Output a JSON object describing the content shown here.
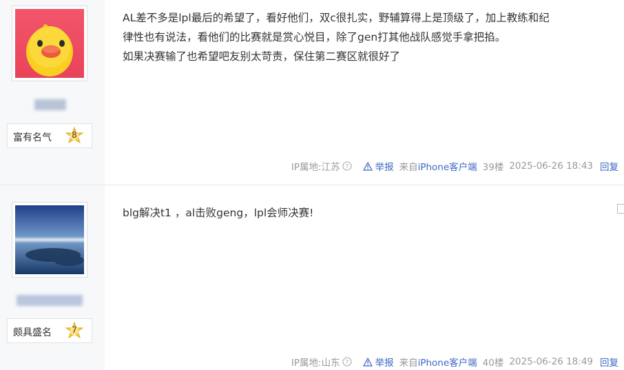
{
  "posts": [
    {
      "level_name": "富有名气",
      "level_num": "8",
      "content_lines": [
        "AL差不多是lpl最后的希望了，看好他们，双c很扎实，野辅算得上是顶级了，加上教练和纪",
        "律性也有说法，看他们的比赛就是赏心悦目，除了gen打其他战队感觉手拿把掐。",
        "如果决赛输了也希望吧友别太苛责，保住第二赛区就很好了"
      ],
      "ip_location": "IP属地:江苏",
      "report_label": "举报",
      "source_prefix": "来自",
      "source_client": "iPhone客户端",
      "floor": "39楼",
      "time": "2025-06-26 18:43",
      "reply_label": "回复",
      "avatar_icon": "yellow-duck-avatar"
    },
    {
      "level_name": "颇具盛名",
      "level_num": "7",
      "content_lines": [
        "blg解决t1 ，al击败geng，lpl会师决赛!"
      ],
      "ip_location": "IP属地:山东",
      "report_label": "举报",
      "source_prefix": "来自",
      "source_client": "iPhone客户端",
      "floor": "40楼",
      "time": "2025-06-26 18:49",
      "reply_label": "回复",
      "avatar_icon": "lake-landscape-avatar"
    }
  ],
  "colors": {
    "link": "#3f67c4",
    "meta_text": "#999999",
    "sidebar_bg": "#f7f8fa",
    "badge": "#f5c542"
  }
}
